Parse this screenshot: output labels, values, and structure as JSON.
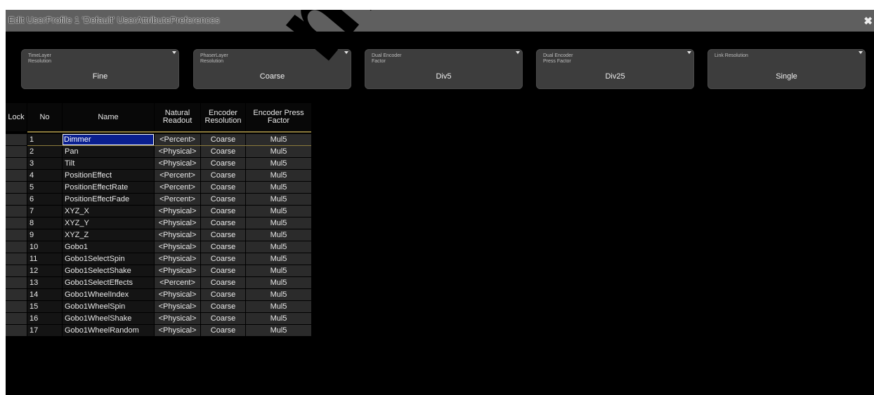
{
  "window": {
    "title": "Edit UserProfile 1 'Default' UserAttributePreferences",
    "close_icon": "close-icon"
  },
  "swatches": [
    {
      "label": "TimeLayer\nResolution",
      "value": "Fine"
    },
    {
      "label": "PhaserLayer\nResolution",
      "value": "Coarse"
    },
    {
      "label": "Dual Encoder\nFactor",
      "value": "Div5"
    },
    {
      "label": "Dual Encoder\nPress Factor",
      "value": "Div25"
    },
    {
      "label": "Link Resolution",
      "value": "Single"
    }
  ],
  "columns": {
    "lock": "Lock",
    "no": "No",
    "name": "Name",
    "readout": "Natural Readout",
    "encoder_resolution": "Encoder Resolution",
    "encoder_press_factor": "Encoder Press Factor"
  },
  "rows": [
    {
      "no": "1",
      "name": "Dimmer",
      "readout": "<Percent>",
      "resolution": "Coarse",
      "factor": "Mul5",
      "selected": true
    },
    {
      "no": "2",
      "name": "Pan",
      "readout": "<Physical>",
      "resolution": "Coarse",
      "factor": "Mul5"
    },
    {
      "no": "3",
      "name": "Tilt",
      "readout": "<Physical>",
      "resolution": "Coarse",
      "factor": "Mul5"
    },
    {
      "no": "4",
      "name": "PositionEffect",
      "readout": "<Percent>",
      "resolution": "Coarse",
      "factor": "Mul5"
    },
    {
      "no": "5",
      "name": "PositionEffectRate",
      "readout": "<Percent>",
      "resolution": "Coarse",
      "factor": "Mul5"
    },
    {
      "no": "6",
      "name": "PositionEffectFade",
      "readout": "<Percent>",
      "resolution": "Coarse",
      "factor": "Mul5"
    },
    {
      "no": "7",
      "name": "XYZ_X",
      "readout": "<Physical>",
      "resolution": "Coarse",
      "factor": "Mul5"
    },
    {
      "no": "8",
      "name": "XYZ_Y",
      "readout": "<Physical>",
      "resolution": "Coarse",
      "factor": "Mul5"
    },
    {
      "no": "9",
      "name": "XYZ_Z",
      "readout": "<Physical>",
      "resolution": "Coarse",
      "factor": "Mul5"
    },
    {
      "no": "10",
      "name": "Gobo1",
      "readout": "<Physical>",
      "resolution": "Coarse",
      "factor": "Mul5"
    },
    {
      "no": "11",
      "name": "Gobo1SelectSpin",
      "readout": "<Physical>",
      "resolution": "Coarse",
      "factor": "Mul5"
    },
    {
      "no": "12",
      "name": "Gobo1SelectShake",
      "readout": "<Physical>",
      "resolution": "Coarse",
      "factor": "Mul5"
    },
    {
      "no": "13",
      "name": "Gobo1SelectEffects",
      "readout": "<Percent>",
      "resolution": "Coarse",
      "factor": "Mul5"
    },
    {
      "no": "14",
      "name": "Gobo1WheelIndex",
      "readout": "<Physical>",
      "resolution": "Coarse",
      "factor": "Mul5"
    },
    {
      "no": "15",
      "name": "Gobo1WheelSpin",
      "readout": "<Physical>",
      "resolution": "Coarse",
      "factor": "Mul5"
    },
    {
      "no": "16",
      "name": "Gobo1WheelShake",
      "readout": "<Physical>",
      "resolution": "Coarse",
      "factor": "Mul5"
    },
    {
      "no": "17",
      "name": "Gobo1WheelRandom",
      "readout": "<Physical>",
      "resolution": "Coarse",
      "factor": "Mul5"
    }
  ],
  "watermark": "mendoza.co"
}
